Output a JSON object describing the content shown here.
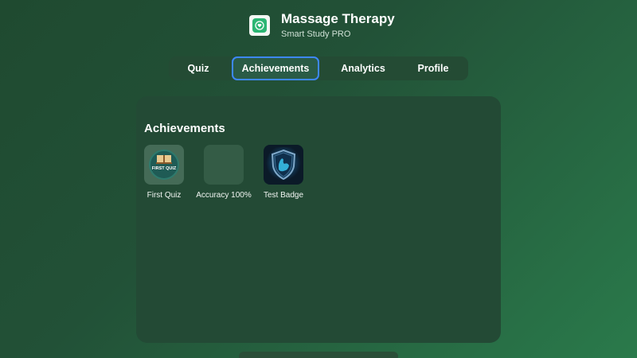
{
  "app": {
    "title": "Massage Therapy",
    "subtitle": "Smart Study PRO",
    "icon": "heart-hands-icon",
    "accent": "#2bb673"
  },
  "tabs": [
    {
      "label": "Quiz",
      "active": false
    },
    {
      "label": "Achievements",
      "active": true
    },
    {
      "label": "Analytics",
      "active": false
    },
    {
      "label": "Profile",
      "active": false
    }
  ],
  "achievements": {
    "heading": "Achievements",
    "badges": [
      {
        "label": "First Quiz",
        "icon": "first-quiz-book-icon",
        "badge_text": "FIRST QUIZ",
        "unlocked": true
      },
      {
        "label": "Accuracy 100%",
        "icon": "locked-placeholder-icon",
        "unlocked": false
      },
      {
        "label": "Test Badge",
        "icon": "shield-muscle-icon",
        "unlocked": true
      }
    ]
  },
  "colors": {
    "active_tab_border": "#3d88ff",
    "background": "#225137"
  }
}
